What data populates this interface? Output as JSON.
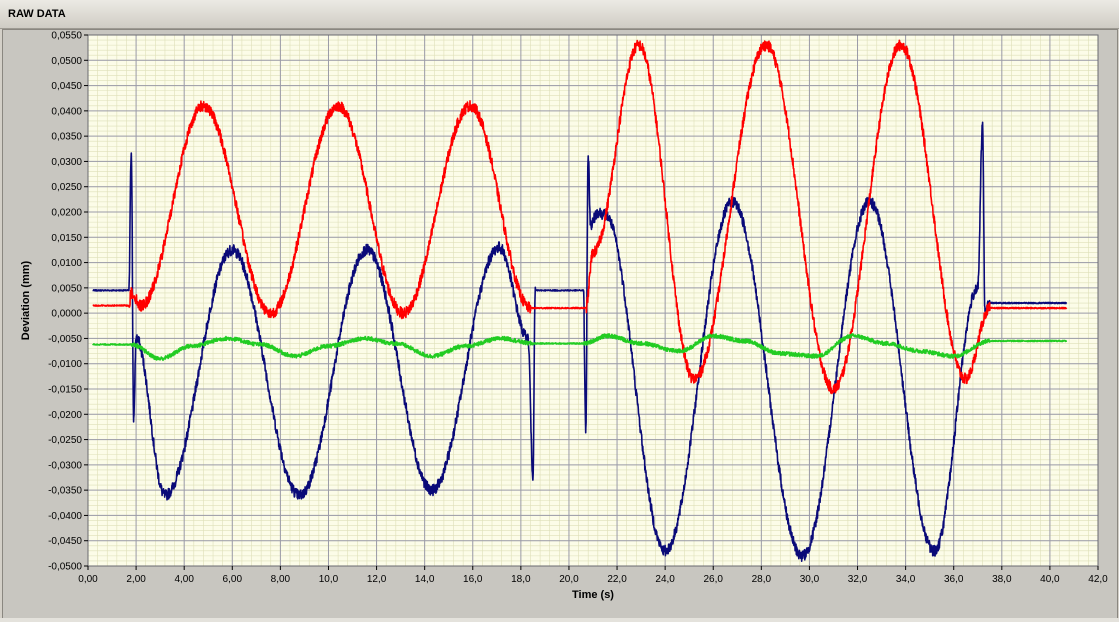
{
  "panel": {
    "title": "RAW DATA"
  },
  "chart_data": {
    "type": "line",
    "title": "",
    "xlabel": "Time (s)",
    "ylabel": "Deviation (mm)",
    "xlim": [
      0,
      42
    ],
    "ylim": [
      -0.05,
      0.055
    ],
    "grid": true,
    "minor_grid": true,
    "legend": "none",
    "colors": {
      "plot_background": "#fcfce8",
      "major_grid": "#9a9aa8",
      "minor_grid": "#dedfb8",
      "axis_text": "#000000"
    },
    "x_ticks": [
      "0,00",
      "2,00",
      "4,00",
      "6,00",
      "8,00",
      "10,0",
      "12,0",
      "14,0",
      "16,0",
      "18,0",
      "20,0",
      "22,0",
      "24,0",
      "26,0",
      "28,0",
      "30,0",
      "32,0",
      "34,0",
      "36,0",
      "38,0",
      "40,0",
      "42,0"
    ],
    "y_ticks": [
      "0,0550",
      "0,0500",
      "0,0450",
      "0,0400",
      "0,0350",
      "0,0300",
      "0,0250",
      "0,0200",
      "0,0150",
      "0,0100",
      "0,0050",
      "0,0000",
      "-0,0050",
      "-0,0100",
      "-0,0150",
      "-0,0200",
      "-0,0250",
      "-0,0300",
      "-0,0350",
      "-0,0400",
      "-0,0450",
      "-0,0500"
    ],
    "series": [
      {
        "color": "#0a0a78",
        "x": [
          0.2,
          1.7,
          1.8,
          1.9,
          2.0,
          3.2,
          6.0,
          8.8,
          11.6,
          14.3,
          17.1,
          18.3,
          18.5,
          18.6,
          18.8,
          20.6,
          20.7,
          20.8,
          20.9,
          21.2,
          21.5,
          24.0,
          26.8,
          29.7,
          32.5,
          35.2,
          37.0,
          37.2,
          37.3,
          37.5,
          38.0,
          40.7
        ],
        "y": [
          0.0045,
          0.0045,
          0.032,
          -0.021,
          -0.005,
          -0.036,
          0.0125,
          -0.036,
          0.0125,
          -0.035,
          0.013,
          -0.005,
          -0.032,
          0.0045,
          0.0045,
          0.0045,
          -0.023,
          0.031,
          0.0175,
          0.02,
          0.0195,
          -0.047,
          0.022,
          -0.048,
          0.022,
          -0.047,
          0.005,
          0.037,
          0.0,
          0.002,
          0.002,
          0.002
        ]
      },
      {
        "color": "#ff0000",
        "x": [
          0.2,
          1.7,
          1.8,
          2.2,
          4.8,
          7.6,
          10.4,
          13.1,
          15.9,
          18.4,
          20.6,
          20.7,
          21.0,
          22.9,
          25.2,
          28.2,
          31.0,
          33.8,
          36.5,
          37.5,
          40.7
        ],
        "y": [
          0.0015,
          0.0015,
          0.004,
          0.0015,
          0.041,
          0.0,
          0.041,
          0.0,
          0.041,
          0.001,
          0.001,
          0.001,
          0.012,
          0.053,
          -0.013,
          0.053,
          -0.015,
          0.053,
          -0.013,
          0.001,
          0.001
        ]
      },
      {
        "color": "#22cc22",
        "x": [
          0.2,
          1.8,
          3.0,
          4.3,
          5.8,
          7.2,
          8.6,
          10.0,
          11.5,
          12.8,
          14.3,
          15.7,
          17.2,
          18.5,
          20.6,
          21.6,
          23.0,
          24.6,
          26.0,
          27.3,
          28.8,
          30.3,
          31.8,
          33.2,
          34.6,
          36.0,
          37.5,
          40.7
        ],
        "y": [
          -0.0062,
          -0.0062,
          -0.009,
          -0.0065,
          -0.005,
          -0.0062,
          -0.0085,
          -0.0065,
          -0.005,
          -0.006,
          -0.0085,
          -0.0065,
          -0.005,
          -0.006,
          -0.006,
          -0.0045,
          -0.006,
          -0.0075,
          -0.0045,
          -0.0055,
          -0.008,
          -0.0085,
          -0.0045,
          -0.006,
          -0.0075,
          -0.0085,
          -0.0055,
          -0.0055
        ]
      }
    ]
  }
}
